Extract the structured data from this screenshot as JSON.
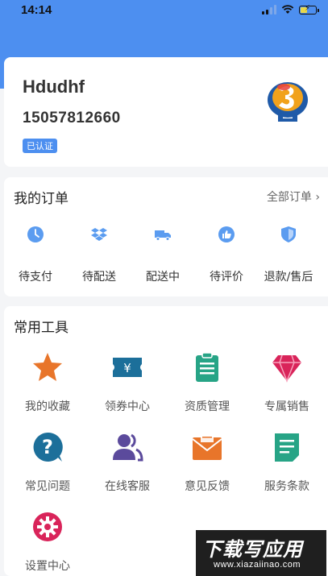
{
  "status_bar": {
    "time": "14:14"
  },
  "profile": {
    "name": "Hdudhf",
    "phone": "15057812660",
    "verified_label": "已认证"
  },
  "orders": {
    "title": "我的订单",
    "all_label": "全部订单 ›",
    "items": [
      {
        "label": "待支付",
        "icon": "clock-icon"
      },
      {
        "label": "待配送",
        "icon": "dropbox-icon"
      },
      {
        "label": "配送中",
        "icon": "truck-icon"
      },
      {
        "label": "待评价",
        "icon": "thumbs-up-icon"
      },
      {
        "label": "退款/售后",
        "icon": "shield-icon"
      }
    ]
  },
  "tools": {
    "title": "常用工具",
    "items": [
      {
        "label": "我的收藏",
        "icon": "star-icon",
        "color": "#e8752a"
      },
      {
        "label": "领券中心",
        "icon": "coupon-icon",
        "color": "#1c6f9a"
      },
      {
        "label": "资质管理",
        "icon": "clipboard-icon",
        "color": "#27a486"
      },
      {
        "label": "专属销售",
        "icon": "diamond-icon",
        "color": "#d9245a"
      },
      {
        "label": "常见问题",
        "icon": "question-icon",
        "color": "#1c6f9a"
      },
      {
        "label": "在线客服",
        "icon": "users-icon",
        "color": "#5b4a9c"
      },
      {
        "label": "意见反馈",
        "icon": "mail-icon",
        "color": "#e8752a"
      },
      {
        "label": "服务条款",
        "icon": "document-icon",
        "color": "#27a486"
      },
      {
        "label": "设置中心",
        "icon": "gear-icon",
        "color": "#d9245a"
      }
    ]
  },
  "watermark": {
    "text_big": "下载写应用",
    "text_small": "www.xiazaiinao.com"
  },
  "colors": {
    "header_blue": "#4d8ff0",
    "order_icon_blue": "#5b9cf0"
  }
}
